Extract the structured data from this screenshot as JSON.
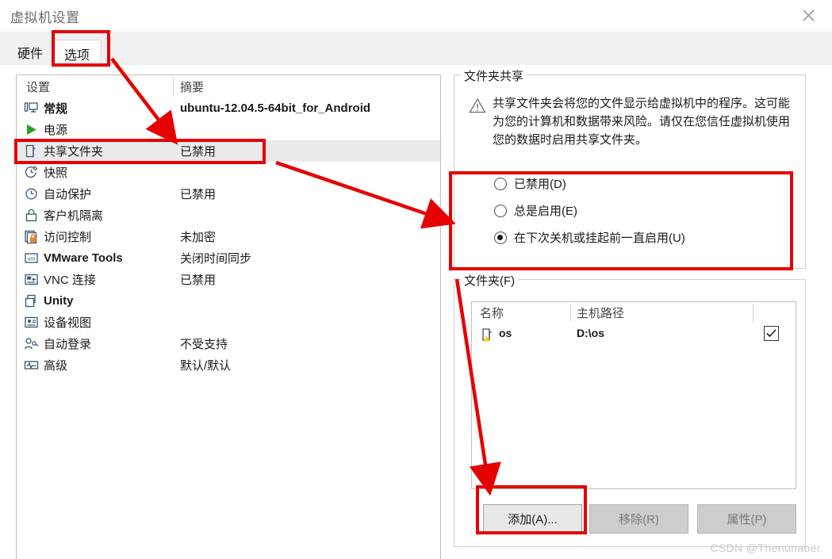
{
  "window": {
    "title": "虚拟机设置",
    "close_icon": "close-icon"
  },
  "tabs": [
    {
      "label": "硬件",
      "active": false
    },
    {
      "label": "选项",
      "active": true
    }
  ],
  "settings_list": {
    "headers": {
      "name": "设置",
      "summary": "摘要"
    },
    "rows": [
      {
        "icon": "monitor-icon",
        "label": "常规",
        "summary": "ubuntu-12.04.5-64bit_for_Android",
        "selected": false,
        "bold": true
      },
      {
        "icon": "play-icon",
        "label": "电源",
        "summary": "",
        "selected": false,
        "bold": false
      },
      {
        "icon": "shared-folder-icon",
        "label": "共享文件夹",
        "summary": "已禁用",
        "selected": true,
        "bold": false
      },
      {
        "icon": "snapshot-icon",
        "label": "快照",
        "summary": "",
        "selected": false,
        "bold": false
      },
      {
        "icon": "autoprotect-icon",
        "label": "自动保护",
        "summary": "已禁用",
        "selected": false,
        "bold": false
      },
      {
        "icon": "lock-icon",
        "label": "客户机隔离",
        "summary": "",
        "selected": false,
        "bold": false
      },
      {
        "icon": "access-control-icon",
        "label": "访问控制",
        "summary": "未加密",
        "selected": false,
        "bold": false
      },
      {
        "icon": "vmware-tools-icon",
        "label": "VMware Tools",
        "summary": "关闭时间同步",
        "selected": false,
        "bold": true
      },
      {
        "icon": "vnc-icon",
        "label": "VNC 连接",
        "summary": "已禁用",
        "selected": false,
        "bold": false
      },
      {
        "icon": "unity-icon",
        "label": "Unity",
        "summary": "",
        "selected": false,
        "bold": true
      },
      {
        "icon": "device-view-icon",
        "label": "设备视图",
        "summary": "",
        "selected": false,
        "bold": false
      },
      {
        "icon": "auto-login-icon",
        "label": "自动登录",
        "summary": "不受支持",
        "selected": false,
        "bold": false
      },
      {
        "icon": "advanced-icon",
        "label": "高级",
        "summary": "默认/默认",
        "selected": false,
        "bold": false
      }
    ]
  },
  "sharing_group": {
    "title": "文件夹共享",
    "warning_icon": "warning-triangle-icon",
    "warning_text": "共享文件夹会将您的文件显示给虚拟机中的程序。这可能为您的计算机和数据带来风险。请仅在您信任虚拟机使用您的数据时启用共享文件夹。",
    "options": [
      {
        "label": "已禁用(D)",
        "checked": false
      },
      {
        "label": "总是启用(E)",
        "checked": false
      },
      {
        "label": "在下次关机或挂起前一直启用(U)",
        "checked": true
      }
    ]
  },
  "folders_group": {
    "title": "文件夹(F)",
    "table": {
      "headers": [
        "名称",
        "主机路径",
        ""
      ],
      "rows": [
        {
          "icon": "shared-folder-warning-icon",
          "name": "os",
          "path": "D:\\os",
          "enabled": true
        }
      ]
    },
    "buttons": [
      {
        "label": "添加(A)...",
        "enabled": true
      },
      {
        "label": "移除(R)",
        "enabled": false
      },
      {
        "label": "属性(P)",
        "enabled": false
      }
    ]
  },
  "watermark": "CSDN @Thenunaoer",
  "colors": {
    "annotation": "#e60000",
    "selection": "#eaeaea",
    "play_green": "#2aa02a",
    "lock_orange": "#f08020",
    "warning_yellow": "#ffd21a"
  }
}
